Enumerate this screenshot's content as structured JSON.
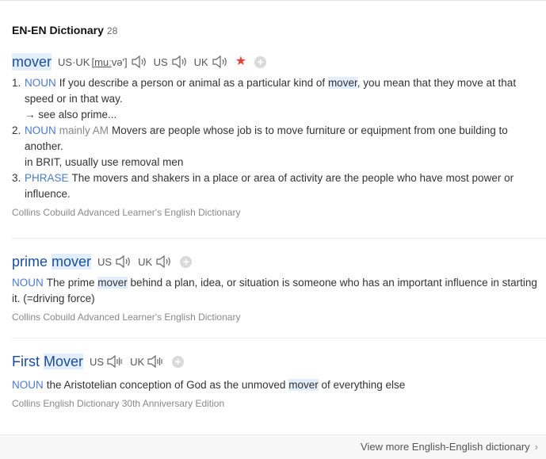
{
  "header": {
    "title": "EN-EN Dictionary",
    "count": "28"
  },
  "entry1": {
    "headword": "mover",
    "pron_label": "US·UK",
    "ipa_open": "[",
    "ipa_underlined": "muː",
    "ipa_rest": "və'",
    "ipa_close": "]",
    "us_label": "US",
    "uk_label": "UK",
    "star_icon": "★",
    "plus": "+",
    "senses": [
      {
        "num": "1.",
        "pos": "NOUN",
        "text_a": "If you describe a person or animal as a particular kind of ",
        "hl": "mover",
        "text_b": ", you mean that they move at that speed or in that way.",
        "extra": "→ see also prime..."
      },
      {
        "num": "2.",
        "pos": "NOUN",
        "region": "mainly AM",
        "text": "Movers are people whose job is to move furniture or equipment from one building to another.",
        "extra": "in BRIT, usually use removal men"
      },
      {
        "num": "3.",
        "pos": "PHRASE",
        "text": "The movers and shakers in a place or area of activity are the people who have most power or influence."
      }
    ],
    "source": "Collins Cobuild Advanced Learner's English Dictionary"
  },
  "entry2": {
    "headword_a": "prime ",
    "headword_hl": "mover",
    "us_label": "US",
    "uk_label": "UK",
    "plus": "+",
    "pos": "NOUN",
    "text_a": "The prime ",
    "hl": "mover",
    "text_b": " behind a plan, idea, or situation is someone who has an important influence in starting it. (=driving force)",
    "source": "Collins Cobuild Advanced Learner's English Dictionary"
  },
  "entry3": {
    "headword_a": "First ",
    "headword_hl": "Mover",
    "us_label": "US",
    "uk_label": "UK",
    "plus": "+",
    "pos": "NOUN",
    "text_a": "the Aristotelian conception of God as the unmoved ",
    "hl": "mover",
    "text_b": " of everything else",
    "source": "Collins English Dictionary 30th Anniversary Edition"
  },
  "footer": {
    "link": "View more English-English dictionary",
    "chevron": "›"
  },
  "colors": {
    "headword": "#1a4d9c",
    "pos": "#4a7cc9",
    "highlight": "#e3eefc",
    "star": "#e34234"
  }
}
